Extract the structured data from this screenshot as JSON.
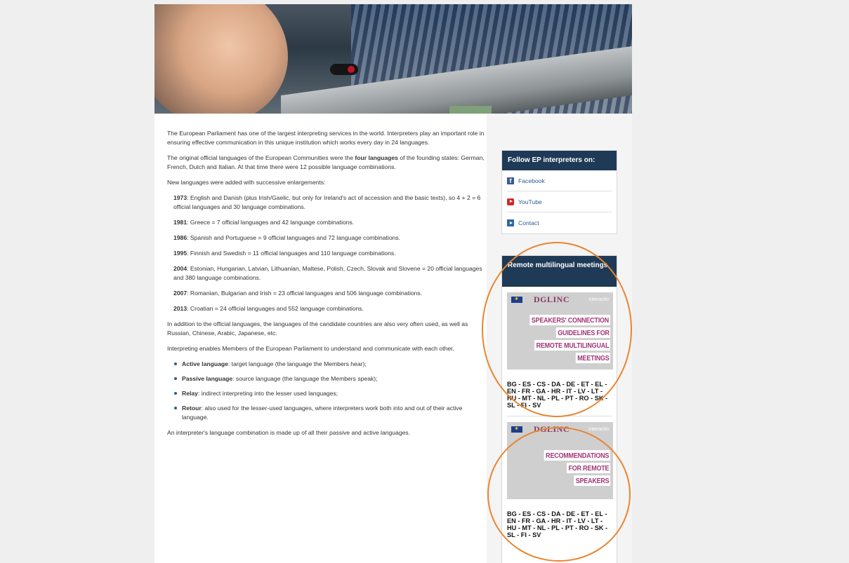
{
  "content": {
    "intro": "The European Parliament has one of the largest interpreting services in the world. Interpreters play an important role in ensuring effective communication in this unique institution which works every day in 24 languages.",
    "original_a": "The original official languages of the European Communities were the ",
    "original_bold": "four languages",
    "original_b": " of the founding states: German, French, Dutch and Italian. At that time there were 12 possible language combinations.",
    "new_languages": "New languages were added with successive enlargements:",
    "enlargements": [
      {
        "year": "1973",
        "text": ": English and Danish (plus Irish/Gaelic, but only for Ireland's act of accession and the basic texts), so 4 + 2 = 6 official languages and 30 language combinations."
      },
      {
        "year": "1981",
        "text": ": Greece = 7 official languages and 42 language combinations."
      },
      {
        "year": "1986",
        "text": ": Spanish and Portuguese = 9 official languages and 72 language combinations."
      },
      {
        "year": "1995",
        "text": ": Finnish and Swedish = 11 official languages and 110 language combinations."
      },
      {
        "year": "2004",
        "text": ": Estonian, Hungarian, Latvian, Lithuanian, Maltese, Polish, Czech, Slovak and Slovene = 20 official languages and 380 language combinations."
      },
      {
        "year": "2007",
        "text": ": Romanian, Bulgarian and Irish = 23 official languages and 506 language combinations."
      },
      {
        "year": "2013",
        "text": ": Croatian = 24 official languages and 552 language combinations."
      }
    ],
    "candidates": "In addition to the official languages, the languages of the candidate countries are also very often used, as well as Russian, Chinese, Arabic, Japanese, etc.",
    "enables": "Interpreting enables Members of the European Parliament to understand and communicate with each other.",
    "terms": [
      {
        "term": "Active language",
        "text": ": target language (the language the Members hear);"
      },
      {
        "term": "Passive language",
        "text": ": source language (the language the Members speak);"
      },
      {
        "term": "Relay",
        "text": ": indirect interpreting into the lesser used languages;"
      },
      {
        "term": "Retour",
        "text": ": also used for the lesser-used languages, where interpreters work both into and out of their active language."
      }
    ],
    "combination": "An interpreter's language combination is made up of all their passive and active languages."
  },
  "sidebar": {
    "follow": {
      "title": "Follow EP interpreters on:",
      "items": [
        {
          "label": "Facebook",
          "icon": "facebook-icon"
        },
        {
          "label": "YouTube",
          "icon": "youtube-icon"
        },
        {
          "label": "Contact",
          "icon": "contact-arrow-icon"
        }
      ]
    },
    "remote": {
      "title": "Remote multilingual meetings",
      "cards": [
        {
          "brand": "DGLINC",
          "tagline": "Interactio",
          "lines": [
            "SPEAKERS' CONNECTION",
            "GUIDELINES FOR",
            "REMOTE MULTILINGUAL",
            "MEETINGS"
          ],
          "languages": "BG - ES - CS - DA - DE - ET - EL - EN - FR - GA - HR - IT - LV - LT - HU - MT - NL - PL - PT - RO - SK - SL - FI - SV"
        },
        {
          "brand": "DGLINC",
          "tagline": "Interactio",
          "lines": [
            "RECOMMENDATIONS",
            "FOR REMOTE",
            "SPEAKERS"
          ],
          "languages": "BG - ES - CS - DA - DE - ET - EL - EN - FR - GA - HR - IT - LV - LT - HU - MT - NL - PL - PT - RO - SK - SL - FI - SV"
        }
      ]
    }
  },
  "colors": {
    "background": "#efefef",
    "header_blue": "#1f3a56",
    "link_blue": "#2a5d8f",
    "card_magenta": "#a23577",
    "annotation_orange": "#e9852f"
  }
}
